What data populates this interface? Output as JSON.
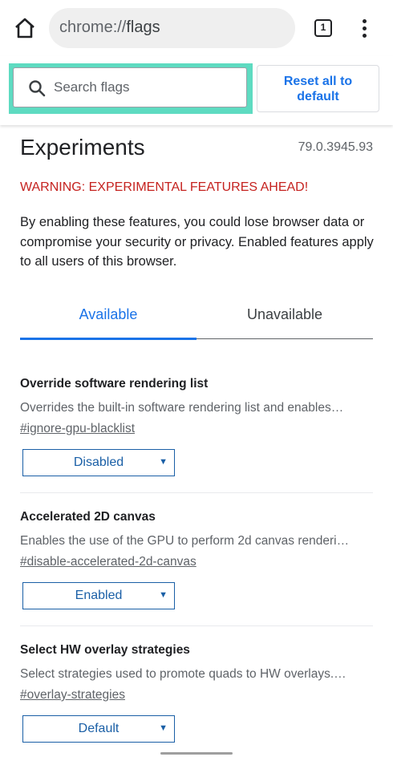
{
  "browser": {
    "url_scheme": "chrome://",
    "url_path": "flags",
    "tab_count": "1"
  },
  "toolbar": {
    "search_placeholder": "Search flags",
    "reset_label": "Reset all to default"
  },
  "page": {
    "title": "Experiments",
    "version": "79.0.3945.93",
    "warning": "WARNING: EXPERIMENTAL FEATURES AHEAD!",
    "description": "By enabling these features, you could lose browser data or compromise your security or privacy. Enabled features apply to all users of this browser."
  },
  "tabs": {
    "available": "Available",
    "unavailable": "Unavailable"
  },
  "flags": [
    {
      "name": "Override software rendering list",
      "description": "Overrides the built-in software rendering list and enables…",
      "link": "#ignore-gpu-blacklist",
      "value": "Disabled"
    },
    {
      "name": "Accelerated 2D canvas",
      "description": "Enables the use of the GPU to perform 2d canvas renderi…",
      "link": "#disable-accelerated-2d-canvas",
      "value": "Enabled"
    },
    {
      "name": "Select HW overlay strategies",
      "description": "Select strategies used to promote quads to HW overlays.…",
      "link": "#overlay-strategies",
      "value": "Default"
    }
  ],
  "colors": {
    "accent": "#1a73e8",
    "warning": "#c5221f",
    "highlight": "#5edbc1"
  }
}
